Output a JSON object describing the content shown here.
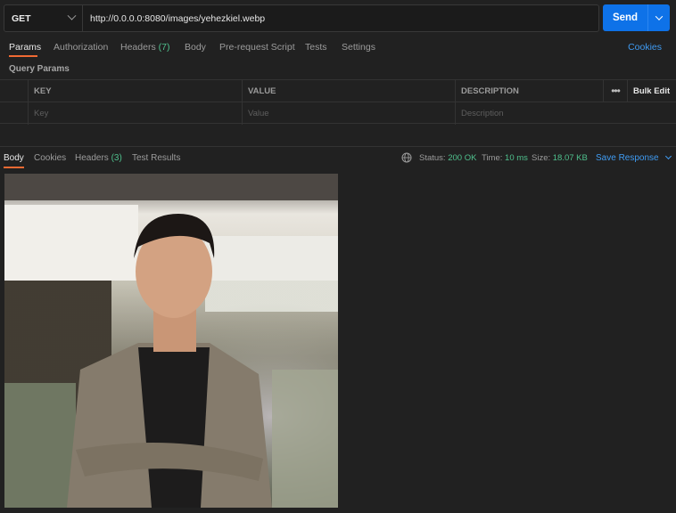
{
  "request": {
    "method": "GET",
    "url": "http://0.0.0.0:8080/images/yehezkiel.webp",
    "send_label": "Send"
  },
  "request_tabs": {
    "params": "Params",
    "authorization": "Authorization",
    "headers": "Headers",
    "headers_count": "(7)",
    "body": "Body",
    "prerequest": "Pre-request Script",
    "tests": "Tests",
    "settings": "Settings",
    "cookies": "Cookies"
  },
  "query_params": {
    "title": "Query Params",
    "headers": {
      "key": "KEY",
      "value": "VALUE",
      "description": "DESCRIPTION",
      "bulk_edit": "Bulk Edit"
    },
    "placeholders": {
      "key": "Key",
      "value": "Value",
      "description": "Description"
    }
  },
  "response": {
    "tabs": {
      "body": "Body",
      "cookies": "Cookies",
      "headers": "Headers",
      "headers_count": "(3)",
      "test_results": "Test Results"
    },
    "status_label": "Status:",
    "status_value": "200 OK",
    "time_label": "Time:",
    "time_value": "10 ms",
    "size_label": "Size:",
    "size_value": "18.07 KB",
    "save_label": "Save Response"
  },
  "colors": {
    "accent": "#0e72e8",
    "active_tab_underline": "#f06a33",
    "success": "#4fc08d",
    "link": "#3f9bf2"
  },
  "icons": [
    "chevron-down-icon",
    "more-icon",
    "globe-icon"
  ]
}
